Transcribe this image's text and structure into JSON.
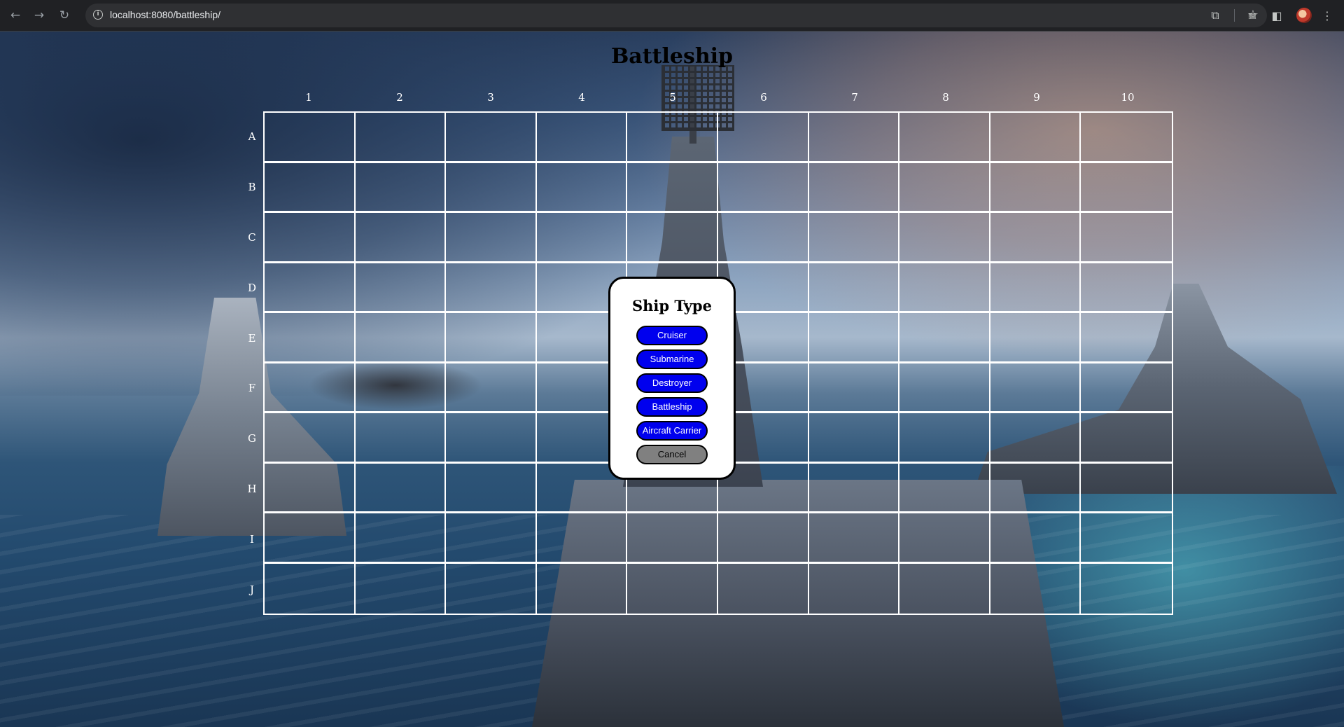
{
  "browser": {
    "url_host": "localhost:8080",
    "url_path": "/battleship/",
    "icons": {
      "back": "arrow-left-icon",
      "forward": "arrow-right-icon",
      "reload": "reload-icon",
      "site_info": "info-icon",
      "bookmark": "star-icon",
      "extensions": "puzzle-icon",
      "media": "media-icon",
      "side_panel": "side-panel-icon",
      "menu": "kebab-menu-icon"
    }
  },
  "game": {
    "title": "Battleship",
    "columns": [
      "1",
      "2",
      "3",
      "4",
      "5",
      "6",
      "7",
      "8",
      "9",
      "10"
    ],
    "rows": [
      "A",
      "B",
      "C",
      "D",
      "E",
      "F",
      "G",
      "H",
      "I",
      "J"
    ]
  },
  "modal": {
    "title": "Ship Type",
    "options": [
      "Cruiser",
      "Submarine",
      "Destroyer",
      "Battleship",
      "Aircraft Carrier"
    ],
    "cancel_label": "Cancel",
    "colors": {
      "option_bg": "#0000ee",
      "option_text": "#ffffff",
      "cancel_bg": "#808080"
    }
  }
}
